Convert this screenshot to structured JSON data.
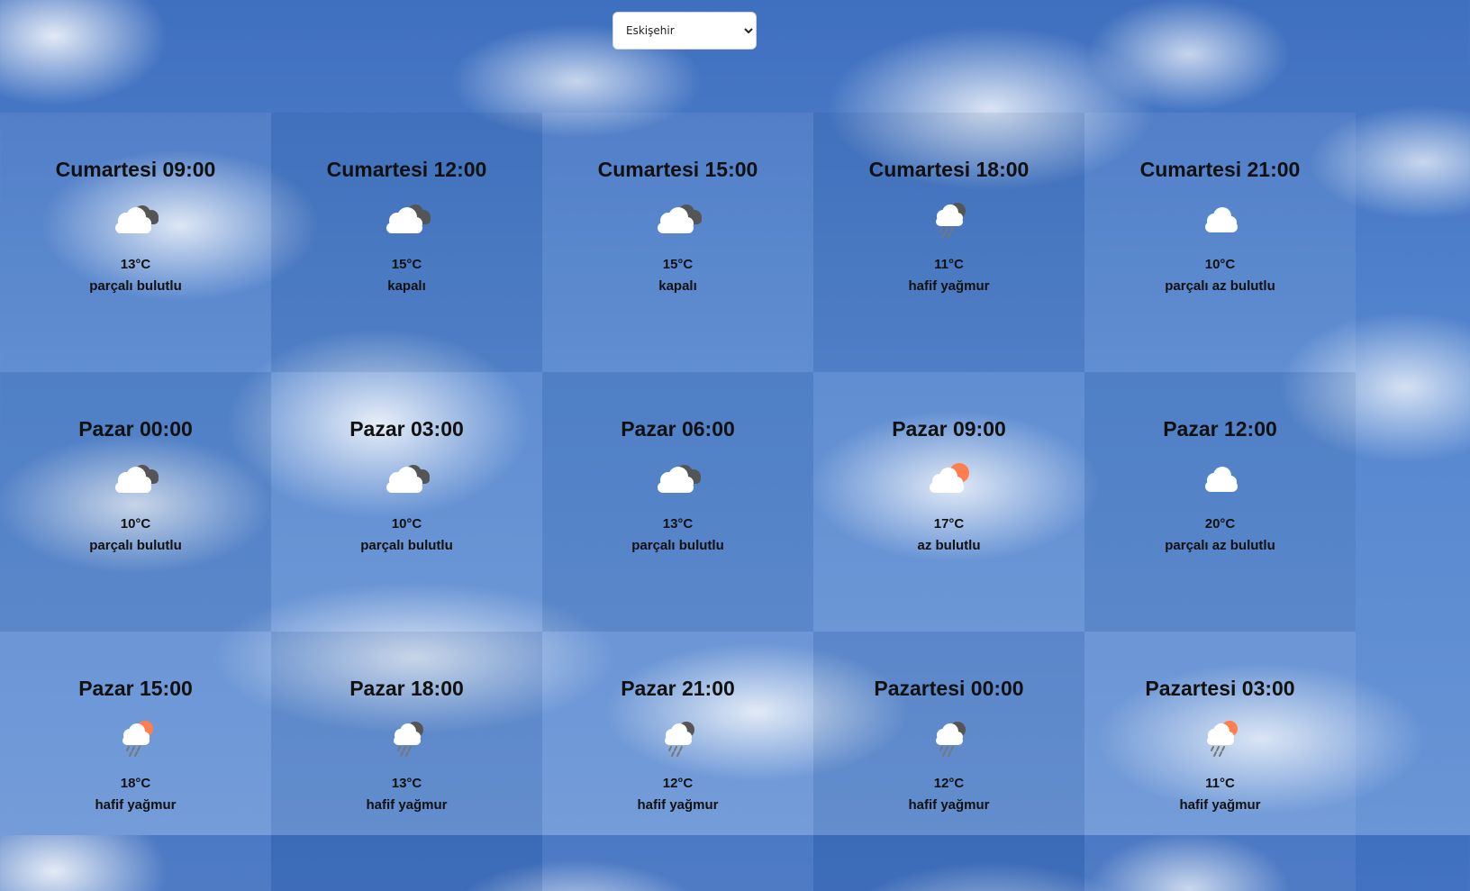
{
  "city_select": {
    "selected": "Eskişehir"
  },
  "colors": {
    "sun": "#ff7e4f",
    "cloud_white": "#ffffff",
    "cloud_dark": "#555555",
    "rain": "#777777"
  },
  "forecasts": [
    {
      "time": "Cumartesi 09:00",
      "temp": "13°C",
      "desc": "parçalı bulutlu",
      "icon": "broken-clouds-icon"
    },
    {
      "time": "Cumartesi 12:00",
      "temp": "15°C",
      "desc": "kapalı",
      "icon": "overcast-clouds-icon"
    },
    {
      "time": "Cumartesi 15:00",
      "temp": "15°C",
      "desc": "kapalı",
      "icon": "overcast-clouds-icon"
    },
    {
      "time": "Cumartesi 18:00",
      "temp": "11°C",
      "desc": "hafif yağmur",
      "icon": "night-rain-icon"
    },
    {
      "time": "Cumartesi 21:00",
      "temp": "10°C",
      "desc": "parçalı az bulutlu",
      "icon": "scattered-clouds-icon"
    },
    {
      "time": "Pazar 00:00",
      "temp": "10°C",
      "desc": "parçalı bulutlu",
      "icon": "broken-clouds-icon"
    },
    {
      "time": "Pazar 03:00",
      "temp": "10°C",
      "desc": "parçalı bulutlu",
      "icon": "broken-clouds-icon"
    },
    {
      "time": "Pazar 06:00",
      "temp": "13°C",
      "desc": "parçalı bulutlu",
      "icon": "broken-clouds-icon"
    },
    {
      "time": "Pazar 09:00",
      "temp": "17°C",
      "desc": "az bulutlu",
      "icon": "few-clouds-day-icon"
    },
    {
      "time": "Pazar 12:00",
      "temp": "20°C",
      "desc": "parçalı az bulutlu",
      "icon": "scattered-clouds-icon"
    },
    {
      "time": "Pazar 15:00",
      "temp": "18°C",
      "desc": "hafif yağmur",
      "icon": "day-rain-icon"
    },
    {
      "time": "Pazar 18:00",
      "temp": "13°C",
      "desc": "hafif yağmur",
      "icon": "night-rain-icon"
    },
    {
      "time": "Pazar 21:00",
      "temp": "12°C",
      "desc": "hafif yağmur",
      "icon": "night-rain-icon"
    },
    {
      "time": "Pazartesi 00:00",
      "temp": "12°C",
      "desc": "hafif yağmur",
      "icon": "night-rain-icon"
    },
    {
      "time": "Pazartesi 03:00",
      "temp": "11°C",
      "desc": "hafif yağmur",
      "icon": "day-rain-icon"
    }
  ]
}
